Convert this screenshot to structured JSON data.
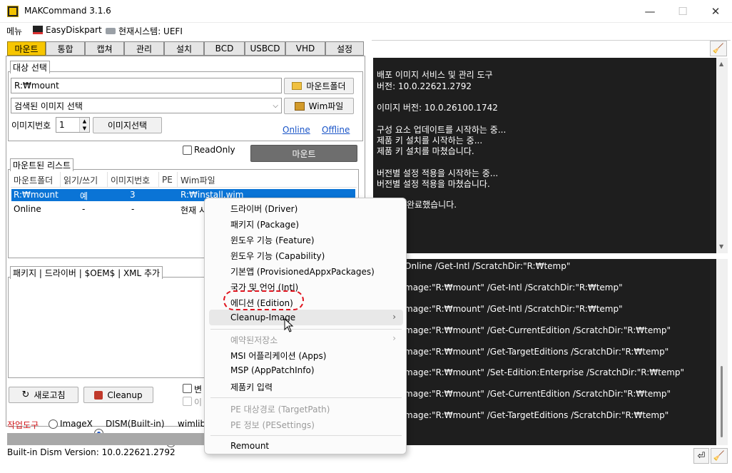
{
  "window": {
    "title": "MAKCommand 3.1.6",
    "minimize": "—",
    "maximize": "☐",
    "close": "✕"
  },
  "menubar": {
    "menu": "메뉴",
    "easydiskpart": "EasyDiskpart",
    "system": "현재시스템: UEFI"
  },
  "tabs": [
    "마운트",
    "통합",
    "캡쳐",
    "관리",
    "설치",
    "BCD",
    "USBCD",
    "VHD",
    "설정"
  ],
  "target": {
    "group_title": "대상 선택",
    "mount_path": "R:₩mount",
    "mount_folder_button": "마운트폴더",
    "image_select": "검색된 이미지 선택",
    "wim_button": "Wim파일",
    "image_number_label": "이미지번호",
    "image_number": "1",
    "image_select_button": "이미지선택",
    "online_link": "Online",
    "offline_link": "Offline",
    "readonly_label": "ReadOnly",
    "mount_button": "마운트"
  },
  "mounted_list": {
    "group_title": "마운트된 리스트",
    "columns": [
      "마운트폴더",
      "읽기/쓰기",
      "이미지번호",
      "PE",
      "Wim파일"
    ],
    "rows": [
      {
        "folder": "R:₩mount",
        "rw": "예",
        "index": "3",
        "pe": "",
        "wim": "R:₩install.wim"
      },
      {
        "folder": "Online",
        "rw": "-",
        "index": "-",
        "pe": "",
        "wim": "현재 시"
      }
    ]
  },
  "packages": {
    "group_title": "패키지 | 드라이버 | $OEM$ | XML 추가"
  },
  "bottom": {
    "refresh_button": "새로고침",
    "cleanup_button": "Cleanup",
    "check_label_1": "변",
    "check_label_2": "이",
    "tool_label": "작업도구",
    "radio_imagex": "ImageX",
    "radio_dism": "DISM(Built-in)",
    "radio_wimlib": "wimlib",
    "status": "Built-in Dism Version: 10.0.22621.2792"
  },
  "console_top": [
    "배포 이미지 서비스 및 관리 도구",
    "버전: 10.0.22621.2792",
    "",
    "이미지 버전: 10.0.26100.1742",
    "",
    "구성 요소 업데이트를 시작하는 중...",
    "제품 키 설치를 시작하는 중...",
    "제품 키 설치를 마쳤습니다.",
    "",
    "버전별 설정 적용을 시작하는 중...",
    "버전별 설정 적용을 마쳤습니다.",
    "",
    "완료했습니다."
  ],
  "console_bottom": [
    "Online /Get-Intl /ScratchDir:\"R:₩temp\"",
    "mage:\"R:₩mount\" /Get-Intl /ScratchDir:\"R:₩temp\"",
    "mage:\"R:₩mount\" /Get-Intl /ScratchDir:\"R:₩temp\"",
    "mage:\"R:₩mount\" /Get-CurrentEdition /ScratchDir:\"R:₩temp\"",
    "mage:\"R:₩mount\" /Get-TargetEditions /ScratchDir:\"R:₩temp\"",
    "mage:\"R:₩mount\" /Set-Edition:Enterprise /ScratchDir:\"R:₩temp\"",
    "mage:\"R:₩mount\" /Get-CurrentEdition /ScratchDir:\"R:₩temp\"",
    "mage:\"R:₩mount\" /Get-TargetEditions /ScratchDir:\"R:₩temp\""
  ],
  "context_menu": {
    "driver": "드라이버 (Driver)",
    "package": "패키지 (Package)",
    "feature": "윈도우 기능 (Feature)",
    "capability": "윈도우 기능 (Capability)",
    "appx": "기본앱 (ProvisionedAppxPackages)",
    "intl": "국가 및 언어 (Intl)",
    "edition": "에디션 (Edition)",
    "cleanup": "Cleanup-Image",
    "reserved": "예약된저장소",
    "msi": "MSI 어플리케이션 (Apps)",
    "msp": "MSP (AppPatchInfo)",
    "productkey": "제품키 입력",
    "pe_target": "PE 대상경로 (TargetPath)",
    "pe_info": "PE 정보 (PESettings)",
    "remount": "Remount"
  },
  "colors": {
    "accent_tab": "#f7c600",
    "selection": "#0a74d6",
    "console_bg": "#1e1e1e",
    "highlight_ring": "#e0151f"
  }
}
